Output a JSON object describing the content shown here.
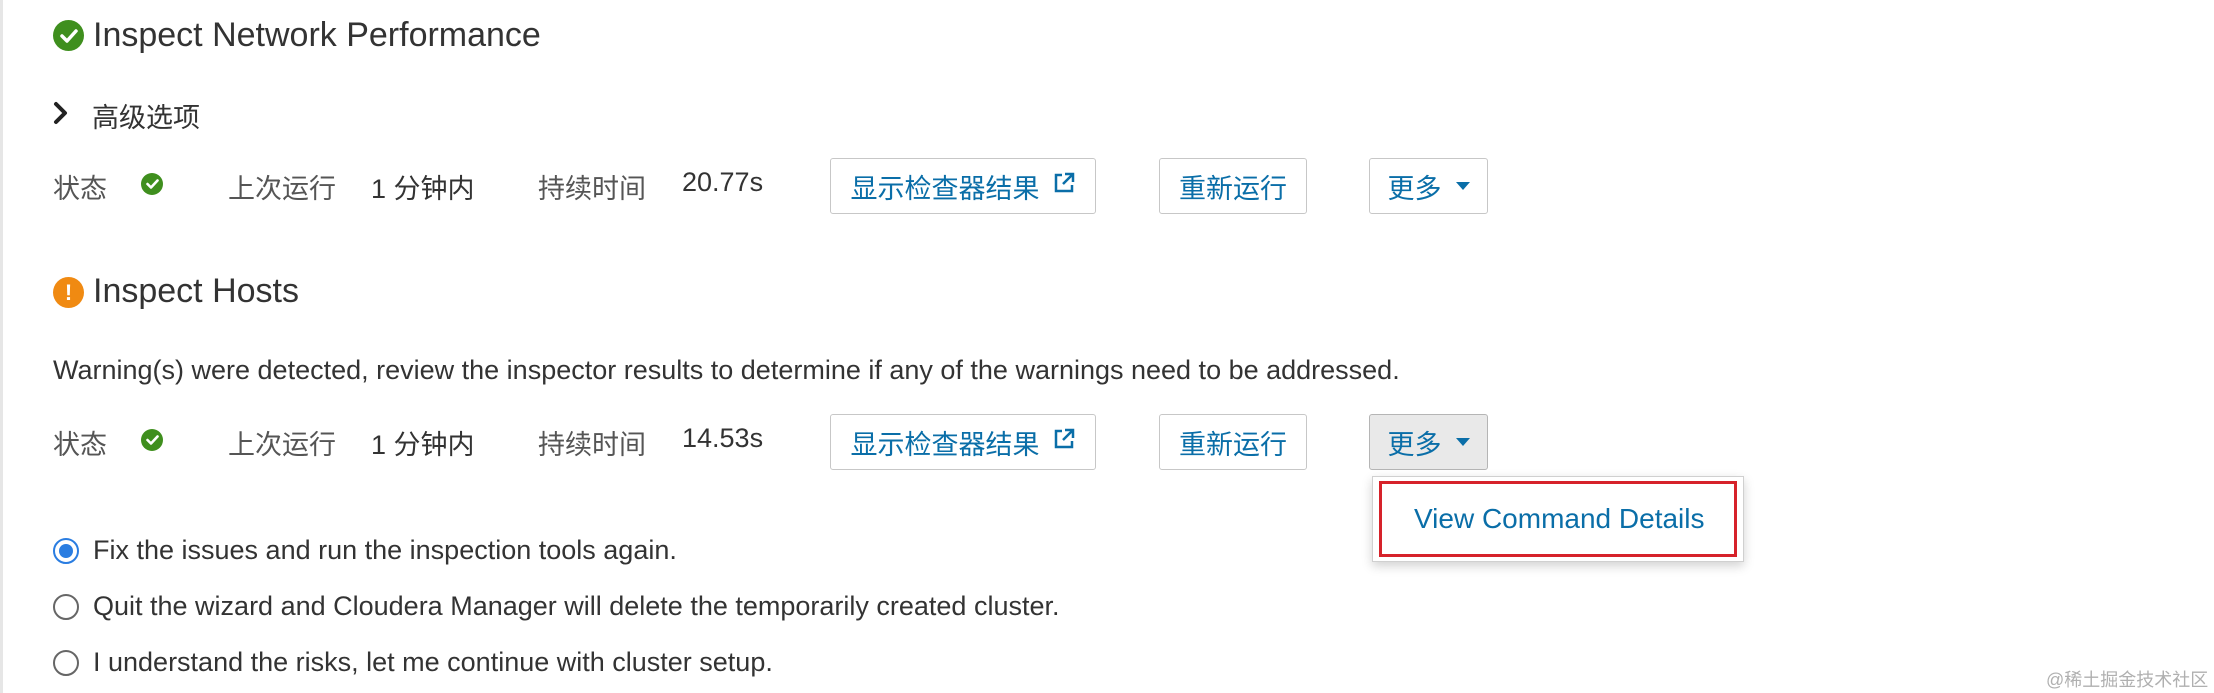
{
  "sections": [
    {
      "title": "Inspect Network Performance",
      "status_icon": "check-circle-icon",
      "advanced_label": "高级选项",
      "status_label": "状态",
      "last_run_label": "上次运行",
      "last_run_value": "1 分钟内",
      "duration_label": "持续时间",
      "duration_value": "20.77s",
      "show_results_label": "显示检查器结果",
      "rerun_label": "重新运行",
      "more_label": "更多"
    },
    {
      "title": "Inspect Hosts",
      "status_icon": "warning-circle-icon",
      "warning": "Warning(s) were detected, review the inspector results to determine if any of the warnings need to be addressed.",
      "status_label": "状态",
      "last_run_label": "上次运行",
      "last_run_value": "1 分钟内",
      "duration_label": "持续时间",
      "duration_value": "14.53s",
      "show_results_label": "显示检查器结果",
      "rerun_label": "重新运行",
      "more_label": "更多",
      "more_menu_open": true
    }
  ],
  "more_menu": {
    "items": [
      "View Command Details"
    ],
    "highlight_color": "#d6222a"
  },
  "options": [
    {
      "label": "Fix the issues and run the inspection tools again.",
      "selected": true
    },
    {
      "label": "Quit the wizard and Cloudera Manager will delete the temporarily created cluster.",
      "selected": false
    },
    {
      "label": "I understand the risks, let me continue with cluster setup.",
      "selected": false
    }
  ],
  "colors": {
    "success": "#3f8f1e",
    "warning": "#f08a12",
    "link": "#0a6ea8",
    "radio_selected": "#2a7de1"
  },
  "watermark": "@稀土掘金技术社区"
}
